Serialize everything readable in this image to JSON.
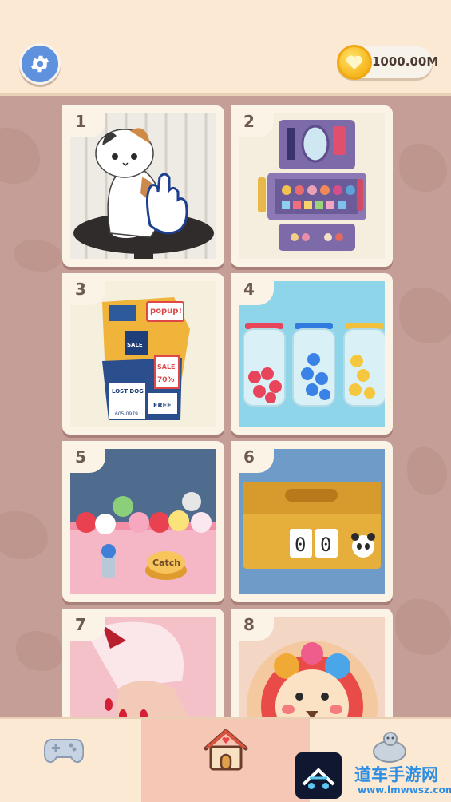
{
  "header": {
    "settings_icon": "gear-icon",
    "currency_icon": "heart-coin-icon",
    "coins": "1000.00M"
  },
  "levels": [
    {
      "number": "1",
      "theme": "cat-on-stool"
    },
    {
      "number": "2",
      "theme": "makeup-kit"
    },
    {
      "number": "3",
      "theme": "poster-wall"
    },
    {
      "number": "4",
      "theme": "ball-jars"
    },
    {
      "number": "5",
      "theme": "claw-machine",
      "button_text": "Catch"
    },
    {
      "number": "6",
      "theme": "tissue-box-counter",
      "counter": [
        "0",
        "0"
      ]
    },
    {
      "number": "7",
      "theme": "manicure"
    },
    {
      "number": "8",
      "theme": "lion-plate"
    }
  ],
  "poster": {
    "popup": "popup!",
    "sale": "SALE",
    "sale2": "SALE",
    "percent": "70%",
    "lost_dog": "LOST DOG",
    "free": "FREE",
    "phone": "605-0979"
  },
  "bottom_nav": {
    "left_icon": "gamepad-icon",
    "center_icon": "house-icon",
    "right_icon": "mascot-icon"
  },
  "watermark": {
    "title": "道车手游网",
    "url": "www.lmwwsz.com"
  },
  "colors": {
    "background": "#c59f97",
    "header": "#fbe9d4",
    "gear_button": "#5f92de",
    "card": "#fbf3e6",
    "nav_active": "#f6c7b4"
  }
}
